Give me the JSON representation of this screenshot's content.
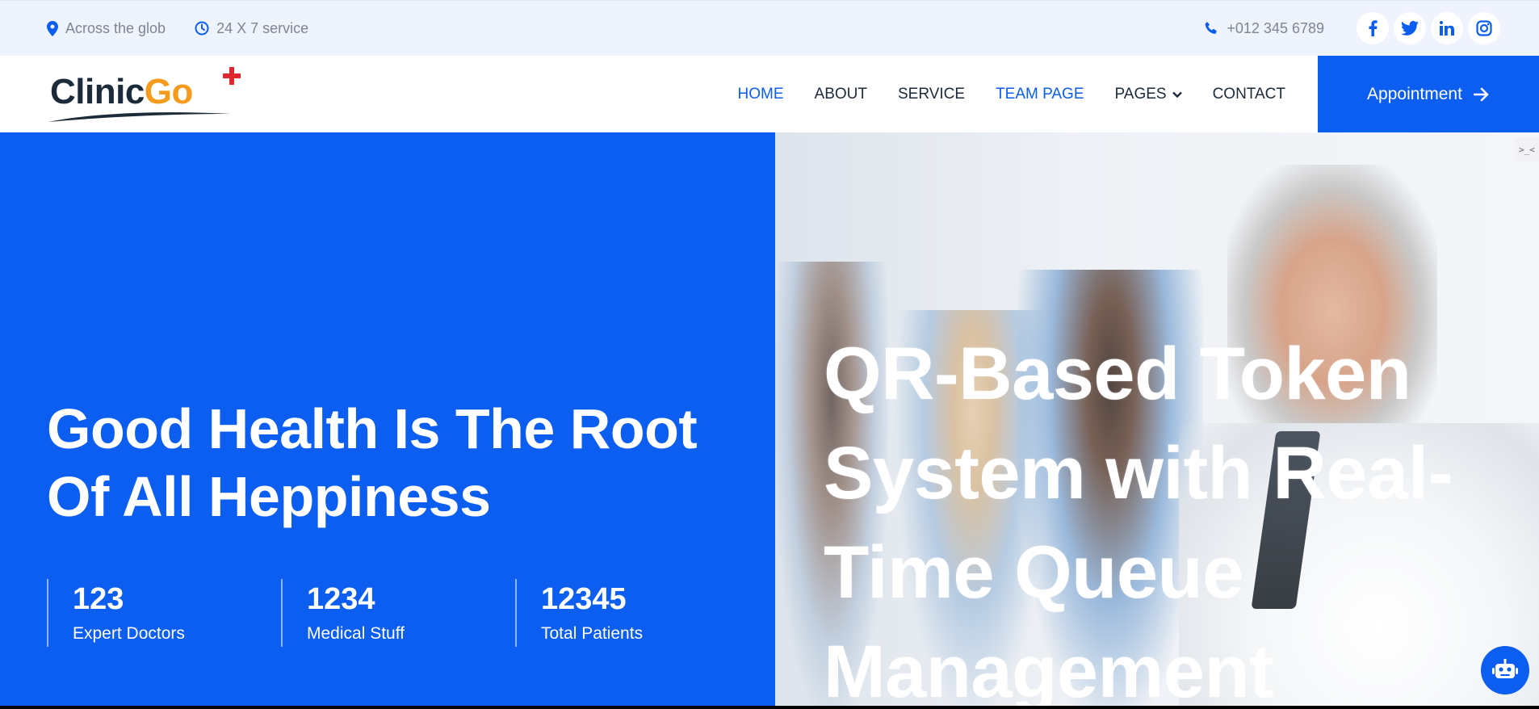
{
  "topbar": {
    "location_text": "Across the glob",
    "hours_text": "24 X 7 service",
    "phone_text": "+012 345 6789",
    "social": [
      {
        "icon": "facebook-icon",
        "glyph": "f"
      },
      {
        "icon": "twitter-icon",
        "glyph": "t"
      },
      {
        "icon": "linkedin-icon",
        "glyph": "in"
      },
      {
        "icon": "instagram-icon",
        "glyph": "ig"
      }
    ]
  },
  "brand": {
    "logo_part1": "Clinic",
    "logo_part2": "Go"
  },
  "nav": {
    "items": [
      {
        "label": "HOME",
        "active": true
      },
      {
        "label": "ABOUT",
        "active": false
      },
      {
        "label": "SERVICE",
        "active": false
      },
      {
        "label": "TEAM PAGE",
        "active": true
      },
      {
        "label": "PAGES",
        "active": false,
        "dropdown": true
      },
      {
        "label": "CONTACT",
        "active": false
      }
    ],
    "cta_label": "Appointment"
  },
  "hero": {
    "title": "Good Health Is The Root Of All Heppiness",
    "overlay_title": "QR-Based Token System with Real-Time Queue Management",
    "stats": [
      {
        "value": "123",
        "label": "Expert Doctors"
      },
      {
        "value": "1234",
        "label": "Medical Stuff"
      },
      {
        "value": "12345",
        "label": "Total Patients"
      }
    ]
  },
  "widget": {
    "side_tab_text": ">_<"
  },
  "colors": {
    "primary": "#0b5ef0",
    "topbar_bg": "#eef3fd",
    "text_dark": "#1c2a3a",
    "text_muted": "#7d8594",
    "logo_accent": "#f49b1c",
    "logo_cross": "#e0262e"
  }
}
